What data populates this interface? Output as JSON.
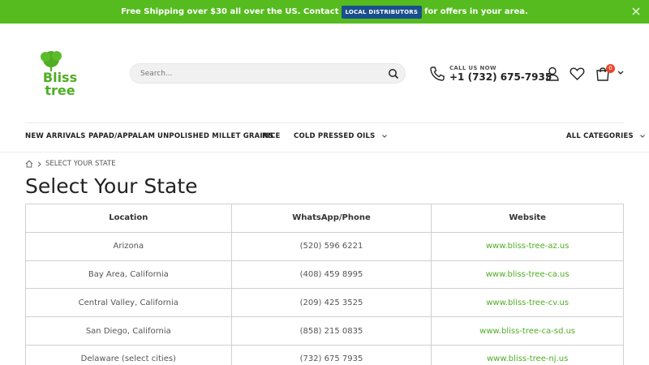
{
  "promo": {
    "text_before": "Free Shipping over $30 all over the US. Contact",
    "button_label": "LOCAL DISTRIBUTORS",
    "text_after": "for offers in your area.",
    "background_color": "#55bb1f",
    "button_color": "#1a4f8d"
  },
  "header": {
    "logo_line1": "Bliss",
    "logo_line2": "tree",
    "search_placeholder": "Search...",
    "call_label": "CALL US NOW",
    "phone": "+1 (732) 675-7935",
    "cart_count": "0",
    "icons": [
      "tree-logo-icon",
      "search-icon",
      "phone-icon",
      "user-icon",
      "heart-icon",
      "cart-icon",
      "chevron-down-icon",
      "close-icon",
      "home-icon"
    ]
  },
  "nav": {
    "items": [
      "NEW ARRIVALS",
      "PAPAD/APPALAM",
      "UNPOLISHED MILLET GRAINS",
      "RICE",
      "COLD PRESSED OILS"
    ],
    "all_categories": "ALL CATEGORIES"
  },
  "breadcrumb": {
    "current": "SELECT YOUR STATE"
  },
  "page": {
    "title": "Select Your State"
  },
  "table": {
    "headers": [
      "Location",
      "WhatsApp/Phone",
      "Website"
    ],
    "rows": [
      [
        "Arizona",
        "(520) 596 6221",
        "www.bliss-tree-az.us"
      ],
      [
        "Bay Area, California",
        "(408) 459 8995",
        "www.bliss-tree-ca.us"
      ],
      [
        "Central Valley, California",
        "(209) 425 3525",
        "www.bliss-tree-cv.us"
      ],
      [
        "San Diego, California",
        "(858) 215 0835",
        "www.bliss-tree-ca-sd.us"
      ],
      [
        "Delaware (select cities)",
        "(732) 675 7935",
        "www.bliss-tree-nj.us"
      ]
    ]
  },
  "colors": {
    "accent": "#4fae23",
    "badge": "#e8452c"
  }
}
